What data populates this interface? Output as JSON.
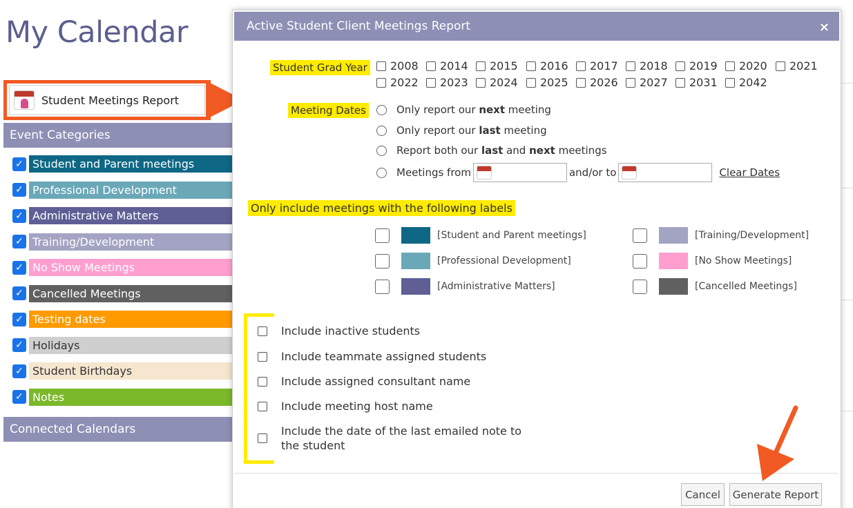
{
  "page": {
    "title": "My Calendar"
  },
  "report_button": {
    "label": "Student Meetings Report"
  },
  "event_categories": {
    "header": "Event Categories",
    "items": [
      {
        "label": "Student and Parent meetings",
        "color": "#0e6784",
        "text_color": "#ffffff"
      },
      {
        "label": "Professional Development",
        "color": "#6aa8b8",
        "text_color": "#ffffff"
      },
      {
        "label": "Administrative Matters",
        "color": "#5f5f96",
        "text_color": "#ffffff"
      },
      {
        "label": "Training/Development",
        "color": "#a3a3c3",
        "text_color": "#ffffff"
      },
      {
        "label": "No Show Meetings",
        "color": "#ff9ecf",
        "text_color": "#ffffff"
      },
      {
        "label": "Cancelled Meetings",
        "color": "#606060",
        "text_color": "#ffffff"
      },
      {
        "label": "Testing dates",
        "color": "#ff9a00",
        "text_color": "#ffffff"
      },
      {
        "label": "Holidays",
        "color": "#cfcfcf",
        "text_color": "#333333"
      },
      {
        "label": "Student Birthdays",
        "color": "#f6e6cf",
        "text_color": "#333333"
      },
      {
        "label": "Notes",
        "color": "#7bb82a",
        "text_color": "#ffffff"
      }
    ]
  },
  "connected_calendars": {
    "header": "Connected Calendars"
  },
  "modal": {
    "title": "Active Student Client Meetings Report",
    "close_icon": "×",
    "grad_year": {
      "label": "Student Grad Year",
      "row1": [
        "2008",
        "2014",
        "2015",
        "2016",
        "2017",
        "2018",
        "2019",
        "2020",
        "2021"
      ],
      "row2": [
        "2022",
        "2023",
        "2024",
        "2025",
        "2026",
        "2027",
        "2031",
        "2042"
      ]
    },
    "meeting_dates": {
      "label": "Meeting Dates",
      "options": [
        {
          "pre": "Only report our ",
          "bold": "next",
          "post": " meeting"
        },
        {
          "pre": "Only report our ",
          "bold": "last",
          "post": " meeting"
        },
        {
          "pre": "Report both our ",
          "bold": "last",
          "mid": " and ",
          "bold2": "next",
          "post": " meetings"
        }
      ],
      "from_label": "Meetings from",
      "to_label": "and/or to",
      "clear_link": "Clear Dates"
    },
    "labels_section": {
      "title": "Only include meetings with the following labels",
      "left": [
        {
          "label": "[Student and Parent meetings]",
          "color": "#0e6784"
        },
        {
          "label": "[Professional Development]",
          "color": "#6aa8b8"
        },
        {
          "label": "[Administrative Matters]",
          "color": "#5f5f96"
        }
      ],
      "right": [
        {
          "label": "[Training/Development]",
          "color": "#a3a3c3"
        },
        {
          "label": "[No Show Meetings]",
          "color": "#ff9ecf"
        },
        {
          "label": "[Cancelled Meetings]",
          "color": "#606060"
        }
      ]
    },
    "options": {
      "items": [
        "Include inactive students",
        "Include teammate assigned students",
        "Include assigned consultant name",
        "Include meeting host name"
      ],
      "last_line1": "Include the date of the last emailed note to",
      "last_line2": "the student"
    },
    "buttons": {
      "cancel": "Cancel",
      "generate": "Generate Report"
    }
  },
  "colors": {
    "accent_orange": "#f15a22",
    "highlight_yellow": "#ffeb00",
    "header_purple": "#8e8fb5"
  }
}
